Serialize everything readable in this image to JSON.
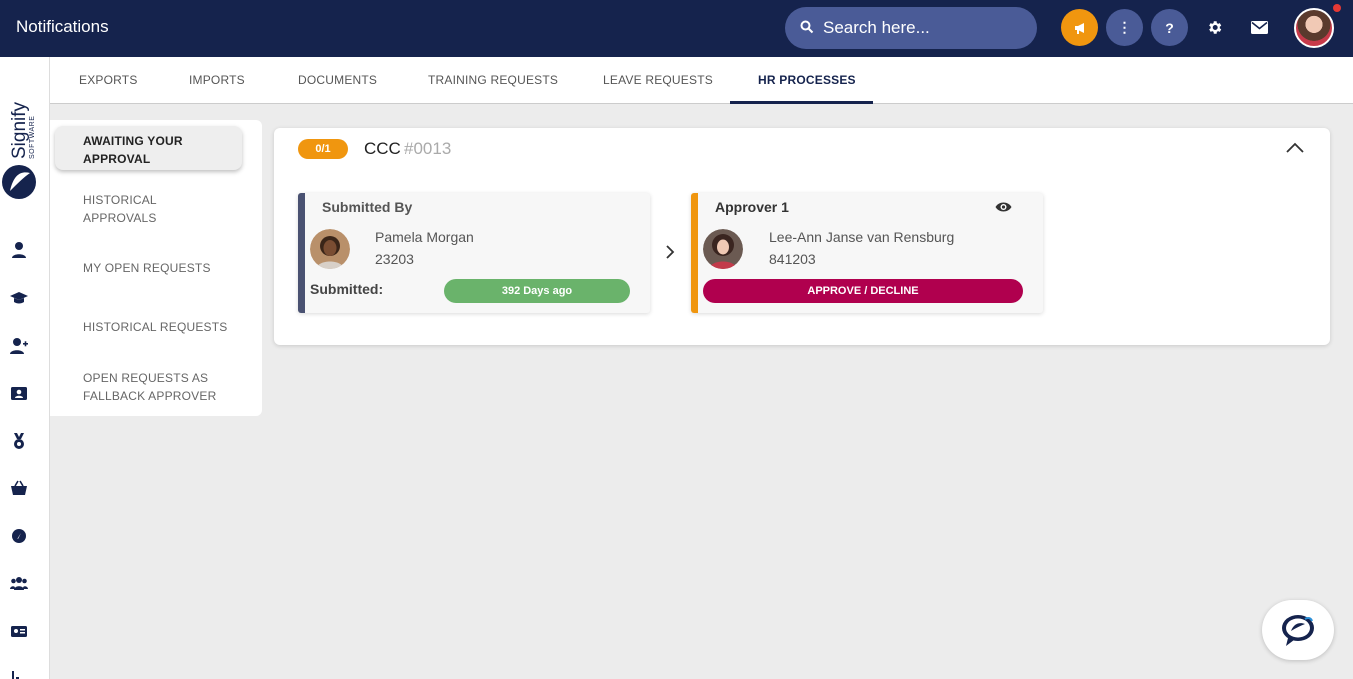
{
  "header": {
    "title": "Notifications"
  },
  "search": {
    "placeholder": "Search here..."
  },
  "topbar": {
    "more_label": "⋮",
    "help_label": "?"
  },
  "tabs": [
    {
      "label": "EXPORTS"
    },
    {
      "label": "IMPORTS"
    },
    {
      "label": "DOCUMENTS"
    },
    {
      "label": "TRAINING REQUESTS"
    },
    {
      "label": "LEAVE REQUESTS"
    },
    {
      "label": "HR PROCESSES",
      "active": true
    }
  ],
  "subnav": {
    "items": [
      {
        "line1": "AWAITING YOUR",
        "line2": "APPROVAL",
        "active": true
      },
      {
        "line1": "HISTORICAL",
        "line2": "APPROVALS"
      },
      {
        "line1": "MY OPEN REQUESTS",
        "line2": ""
      },
      {
        "line1": "HISTORICAL REQUESTS",
        "line2": ""
      },
      {
        "line1": "OPEN REQUESTS AS",
        "line2": "FALLBACK APPROVER"
      }
    ]
  },
  "process": {
    "progress": "0/1",
    "name": "CCC",
    "number": "#0013"
  },
  "submitted_by": {
    "heading": "Submitted By",
    "name": "Pamela Morgan",
    "employee_no": "23203",
    "submitted_label": "Submitted:",
    "age": "392 Days ago"
  },
  "approver": {
    "heading": "Approver 1",
    "name": "Lee-Ann Janse van Rensburg",
    "employee_no": "841203",
    "action_label": "APPROVE / DECLINE"
  },
  "logo": {
    "text": "Signify",
    "subtext": "SOFTWARE"
  },
  "colors": {
    "navy": "#15234d",
    "accent_orange": "#f0960f",
    "approve": "#b0004e",
    "days_green": "#6ab36b"
  }
}
